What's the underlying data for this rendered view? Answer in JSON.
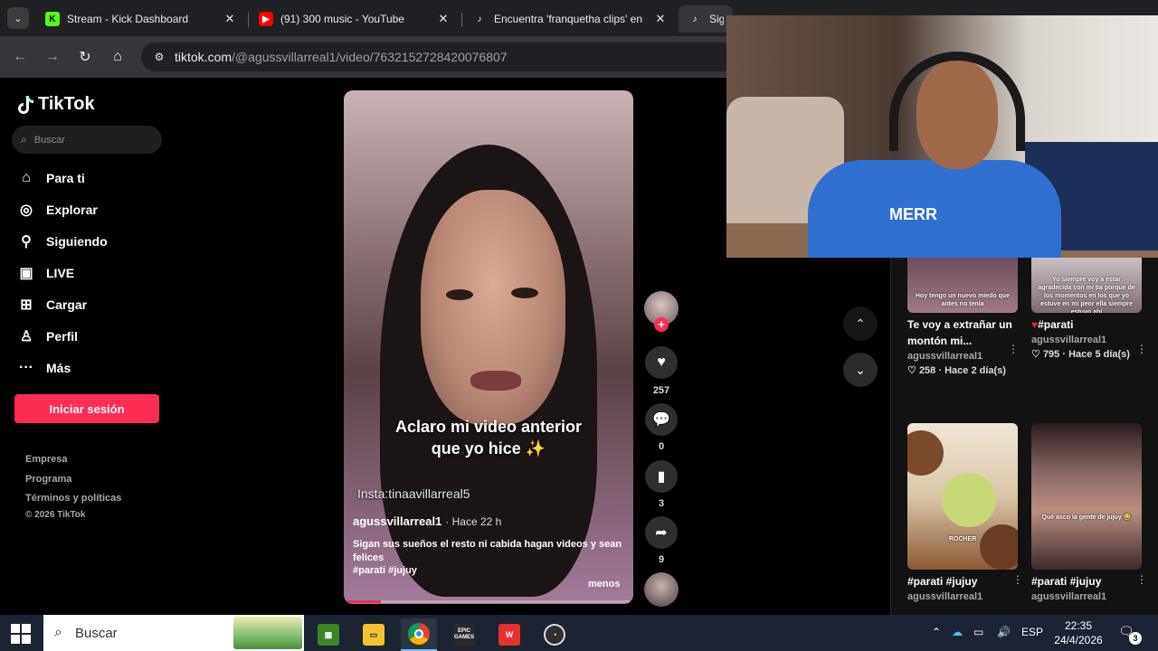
{
  "browser": {
    "tabs": [
      {
        "title": "Stream - Kick Dashboard",
        "icon": "kick-icon"
      },
      {
        "title": "(91) 300 music - YouTube",
        "icon": "youtube-icon"
      },
      {
        "title": "Encuentra 'franquetha clips' en",
        "icon": "tiktok-icon"
      },
      {
        "title": "Siga",
        "icon": "tiktok-icon"
      }
    ],
    "url_host": "tiktok.com",
    "url_path": "/@agussvillarreal1/video/7632152728420076807"
  },
  "sidebar": {
    "logo": "TikTok",
    "search_placeholder": "Buscar",
    "nav": [
      {
        "label": "Para ti",
        "icon": "home-icon"
      },
      {
        "label": "Explorar",
        "icon": "compass-icon"
      },
      {
        "label": "Siguiendo",
        "icon": "following-icon"
      },
      {
        "label": "LIVE",
        "icon": "live-icon"
      },
      {
        "label": "Cargar",
        "icon": "upload-icon"
      },
      {
        "label": "Perfil",
        "icon": "profile-icon"
      },
      {
        "label": "Más",
        "icon": "more-icon"
      }
    ],
    "login": "Iniciar sesión",
    "footer": [
      "Empresa",
      "Programa",
      "Términos y políticas"
    ],
    "copyright": "© 2026 TikTok"
  },
  "video": {
    "caption_line1": "Aclaro mi video anterior",
    "caption_line2": "que yo hice ✨",
    "insta": "Insta:tinaavillarreal5",
    "author": "agussvillarreal1",
    "time": "· Hace 22 h",
    "description": "Sigan sus sueños el resto ni cabida hagan videos y sean felices",
    "tags": "#parati #jujuy",
    "less": "menos",
    "progress": 0.12
  },
  "actions": {
    "likes": "257",
    "comments": "0",
    "saves": "3",
    "shares": "9"
  },
  "related": [
    {
      "title": "Te voy a extrañar un montón mi...",
      "author": "agussvillarreal1",
      "likes": "258",
      "time": "Hace 2 día(s)",
      "overlay": "Hoy tengo un nuevo miedo que antes no tenía"
    },
    {
      "title": "#parati",
      "author": "agussvillarreal1",
      "likes": "795",
      "time": "Hace 5 día(s)",
      "overlay": "Yo siempre voy a estar agradecida con mi tía porque de los momentos en los que yo estuve en mi peor ella siempre estuvo ahí"
    },
    {
      "title": "#parati #jujuy",
      "author": "agussvillarreal1",
      "overlay": "ROCHER"
    },
    {
      "title": "#parati #jujuy",
      "author": "agussvillarreal1",
      "overlay": "Qué asco la gente de jujuy 😂"
    }
  ],
  "webcam": {
    "shirt_text": "MERR"
  },
  "taskbar": {
    "search_label": "Buscar",
    "apps": [
      "minecraft-icon",
      "file-explorer-icon",
      "chrome-icon",
      "epic-games-icon",
      "wps-icon",
      "obs-icon"
    ],
    "epic_label": "EPIC GAMES",
    "lang": "ESP",
    "time": "22:35",
    "date": "24/4/2026",
    "notif_count": "3"
  },
  "colors": {
    "accent": "#fe2c55",
    "browser_tab": "#35363a",
    "taskbar": "#1c2433"
  }
}
